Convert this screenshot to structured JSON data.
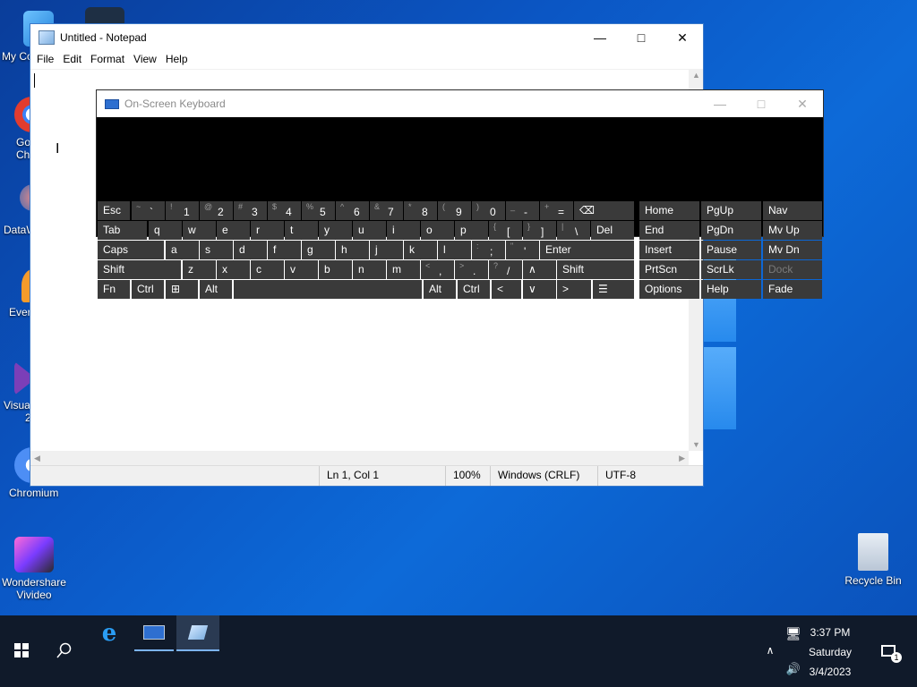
{
  "desktop": {
    "icons": [
      {
        "label": "My Co"
      },
      {
        "label": "Go"
      },
      {
        "label": "Ch"
      },
      {
        "label": "DataW"
      },
      {
        "label": "Ever"
      },
      {
        "label": "Visua"
      },
      {
        "label": "2"
      },
      {
        "label": "Chromium"
      },
      {
        "label": "Wondershare"
      },
      {
        "label": "Vivideo"
      },
      {
        "label": "Recycle Bin"
      }
    ]
  },
  "notepad": {
    "title": "Untitled - Notepad",
    "menu": [
      "File",
      "Edit",
      "Format",
      "View",
      "Help"
    ],
    "status": {
      "position": "Ln 1, Col 1",
      "zoom": "100%",
      "line_ending": "Windows (CRLF)",
      "encoding": "UTF-8"
    }
  },
  "osk": {
    "title": "On-Screen Keyboard",
    "keys": {
      "esc": "Esc",
      "tab": "Tab",
      "caps": "Caps",
      "shift": "Shift",
      "fn": "Fn",
      "ctrl": "Ctrl",
      "alt": "Alt",
      "del": "Del",
      "enter": "Enter",
      "shift_r": "Shift",
      "alt_r": "Alt",
      "ctrl_r": "Ctrl",
      "home": "Home",
      "pgup": "PgUp",
      "nav": "Nav",
      "end": "End",
      "pgdn": "PgDn",
      "mvup": "Mv Up",
      "insert": "Insert",
      "pause": "Pause",
      "mvdn": "Mv Dn",
      "prtscn": "PrtScn",
      "scrlk": "ScrLk",
      "dock": "Dock",
      "options": "Options",
      "help": "Help",
      "fade": "Fade"
    },
    "row1": [
      [
        "~",
        "`"
      ],
      [
        "!",
        "1"
      ],
      [
        "@",
        "2"
      ],
      [
        "#",
        "3"
      ],
      [
        "$",
        "4"
      ],
      [
        "%",
        "5"
      ],
      [
        "^",
        "6"
      ],
      [
        "&",
        "7"
      ],
      [
        "*",
        "8"
      ],
      [
        "(",
        "9"
      ],
      [
        ")",
        "0"
      ],
      [
        "_",
        "-"
      ],
      [
        "+",
        "="
      ]
    ],
    "row2": [
      "q",
      "w",
      "e",
      "r",
      "t",
      "y",
      "u",
      "i",
      "o",
      "p"
    ],
    "row2_sym": [
      [
        "{",
        "["
      ],
      [
        "}",
        "]"
      ],
      [
        "|",
        "\\"
      ]
    ],
    "row3": [
      "a",
      "s",
      "d",
      "f",
      "g",
      "h",
      "j",
      "k",
      "l"
    ],
    "row3_sym": [
      [
        ":",
        ";"
      ],
      [
        "\"",
        "'"
      ]
    ],
    "row4": [
      "z",
      "x",
      "c",
      "v",
      "b",
      "n",
      "m"
    ],
    "row4_sym": [
      [
        "<",
        ","
      ],
      [
        ">",
        "."
      ],
      [
        "?",
        "/"
      ]
    ]
  },
  "taskbar": {
    "time": "3:37 PM",
    "day": "Saturday",
    "date": "3/4/2023",
    "notification_count": "1"
  }
}
